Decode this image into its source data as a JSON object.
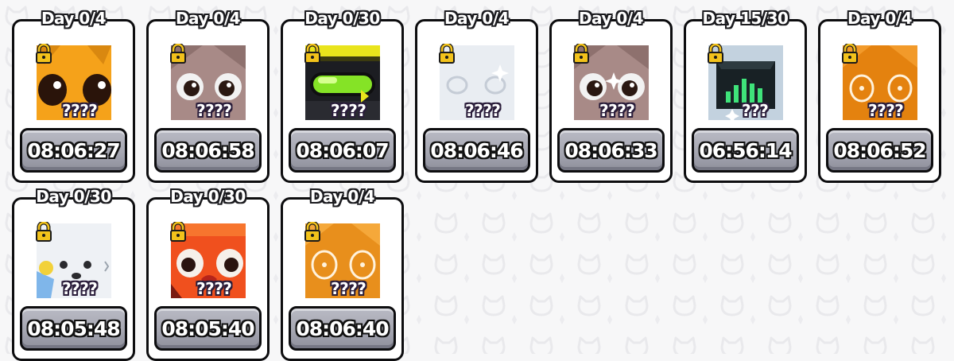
{
  "rewards": [
    {
      "day_label": "Day 0/4",
      "name_hidden": "????",
      "timer": "08:06:27",
      "pet_icon": "orange-cat-pet-icon",
      "locked": true
    },
    {
      "day_label": "Day 0/4",
      "name_hidden": "????",
      "timer": "08:06:58",
      "pet_icon": "brown-dog-pet-icon",
      "locked": true
    },
    {
      "day_label": "Day 0/30",
      "name_hidden": "????",
      "timer": "08:06:07",
      "pet_icon": "green-goggles-pet-icon",
      "locked": true
    },
    {
      "day_label": "Day 0/4",
      "name_hidden": "????",
      "timer": "08:06:46",
      "pet_icon": "white-cloud-pet-icon",
      "locked": true
    },
    {
      "day_label": "Day 0/4",
      "name_hidden": "????",
      "timer": "08:06:33",
      "pet_icon": "brown-dog-pet-icon",
      "locked": true
    },
    {
      "day_label": "Day 15/30",
      "name_hidden": "???",
      "timer": "06:56:14",
      "pet_icon": "equalizer-pet-icon",
      "locked": true
    },
    {
      "day_label": "Day 0/4",
      "name_hidden": "????",
      "timer": "08:06:52",
      "pet_icon": "orange-fox-pet-icon",
      "locked": true
    },
    {
      "day_label": "Day 0/30",
      "name_hidden": "????",
      "timer": "08:05:48",
      "pet_icon": "white-seal-pet-icon",
      "locked": true
    },
    {
      "day_label": "Day 0/30",
      "name_hidden": "????",
      "timer": "08:05:40",
      "pet_icon": "red-bird-pet-icon",
      "locked": true
    },
    {
      "day_label": "Day 0/4",
      "name_hidden": "????",
      "timer": "08:06:40",
      "pet_icon": "orange-fox-pet-icon",
      "locked": true
    }
  ],
  "colors": {
    "card_border": "#0d0d0f",
    "timer_button": "#a6a7b2",
    "lock": "#f2c21b"
  }
}
